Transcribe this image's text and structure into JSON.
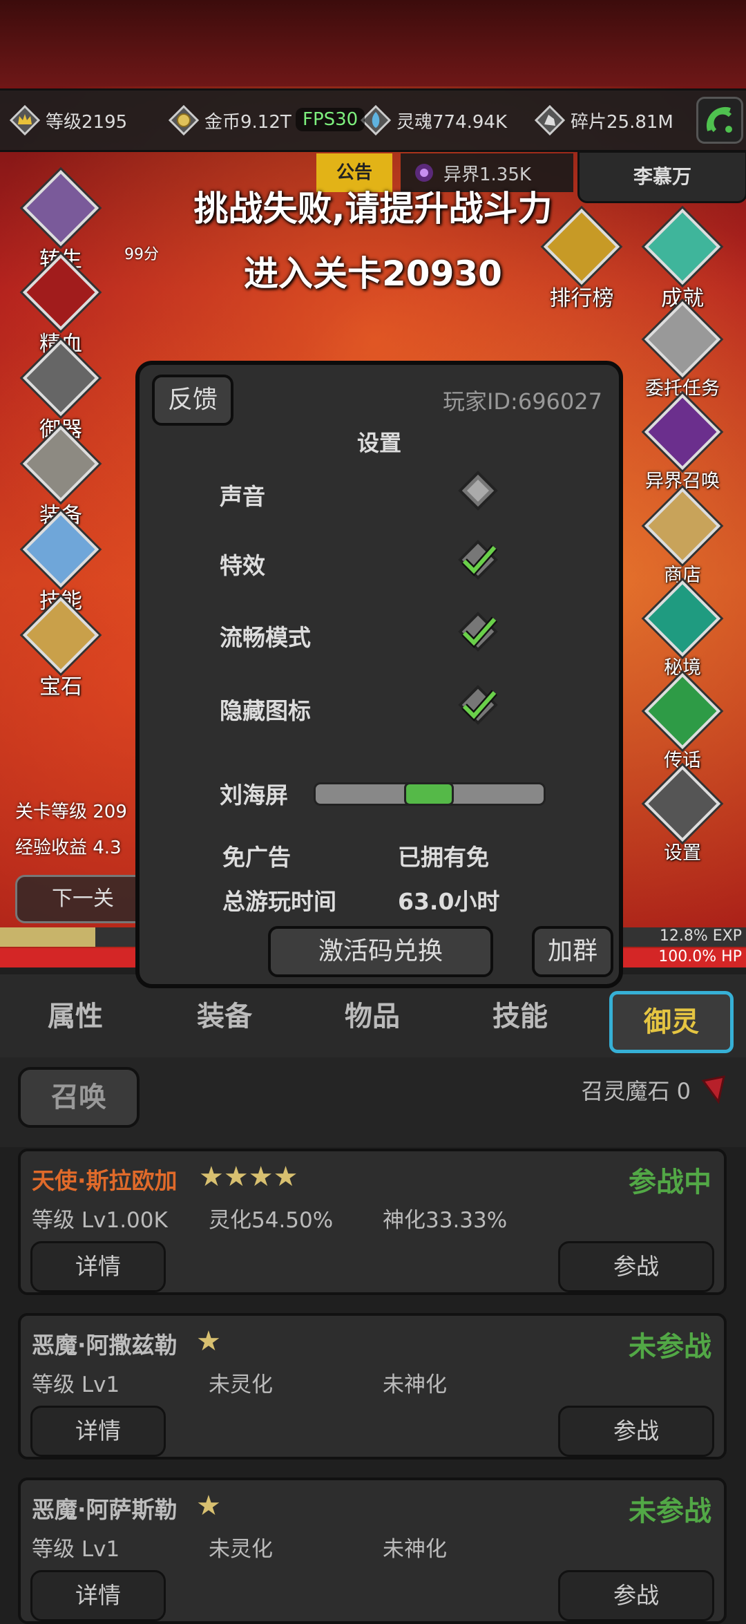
{
  "resources": {
    "level": "等级2195",
    "gold": "金币9.12T",
    "fps": "FPS30",
    "soul": "灵魂774.94K",
    "shards": "碎片25.81M"
  },
  "notice": "公告",
  "otherworld": "异界1.35K",
  "player_name": "李慕万",
  "score_badge": "99分",
  "banner": {
    "line1": "挑战失败,请提升战斗力",
    "line2": "进入关卡20930"
  },
  "left_menu": [
    "转生",
    "精血",
    "御器",
    "装备",
    "技能",
    "宝石"
  ],
  "right_menu": [
    "排行榜",
    "成就",
    "委托任务",
    "异界召唤",
    "商店",
    "秘境",
    "传话",
    "设置"
  ],
  "left_stats": {
    "stage_level": "关卡等级 209",
    "exp_gain": "经验收益 4.3"
  },
  "next_stage": "下一关",
  "exp": {
    "label": "12.8% EXP",
    "fraction": 0.128
  },
  "hp": {
    "label": "100.0% HP",
    "fraction": 1.0
  },
  "settings": {
    "feedback": "反馈",
    "player_id": "玩家ID:696027",
    "title": "设置",
    "sound": "声音",
    "effects": "特效",
    "smooth": "流畅模式",
    "hide_icons": "隐藏图标",
    "notch": "刘海屏",
    "ad_free": "免广告",
    "ad_free_value": "已拥有免",
    "playtime": "总游玩时间",
    "playtime_value": "63.0小时",
    "redeem": "激活码兑换",
    "join_group": "加群"
  },
  "tabs": [
    "属性",
    "装备",
    "物品",
    "技能",
    "御灵"
  ],
  "summon": {
    "button": "召唤",
    "stone": "召灵魔石 0"
  },
  "spirits": [
    {
      "name": "天使·斯拉欧加",
      "stars": "★★★★",
      "status": "参战中",
      "level": "等级 Lv1.00K",
      "spirit": "灵化54.50%",
      "divine": "神化33.33%",
      "detail": "详情",
      "deploy": "参战",
      "name_color": "#e06a2a"
    },
    {
      "name": "恶魔·阿撒兹勒",
      "stars": "★",
      "status": "未参战",
      "level": "等级 Lv1",
      "spirit": "未灵化",
      "divine": "未神化",
      "detail": "详情",
      "deploy": "参战",
      "name_color": "#bdbdbd"
    },
    {
      "name": "恶魔·阿萨斯勒",
      "stars": "★",
      "status": "未参战",
      "level": "等级 Lv1",
      "spirit": "未灵化",
      "divine": "未神化",
      "detail": "详情",
      "deploy": "参战",
      "name_color": "#bdbdbd"
    }
  ]
}
